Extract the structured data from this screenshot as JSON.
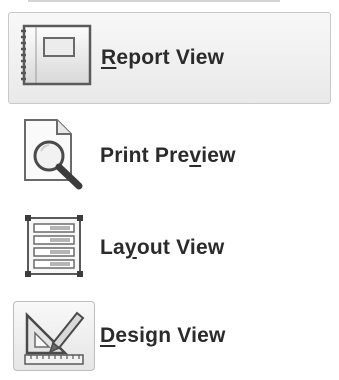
{
  "menu": {
    "items": [
      {
        "label": "Report View",
        "mnemonic": "R",
        "rest": "eport View",
        "selected": true,
        "icon": "report-view-icon"
      },
      {
        "label": "Print Preview",
        "before": "Print Pre",
        "mnemonic": "v",
        "after": "iew",
        "selected": false,
        "icon": "print-preview-icon"
      },
      {
        "label": "Layout View",
        "before": "La",
        "mnemonic": "y",
        "after": "out View",
        "selected": false,
        "icon": "layout-view-icon"
      },
      {
        "label": "Design View",
        "mnemonic": "D",
        "rest": "esign View",
        "selected": false,
        "icon": "design-view-icon"
      }
    ]
  }
}
